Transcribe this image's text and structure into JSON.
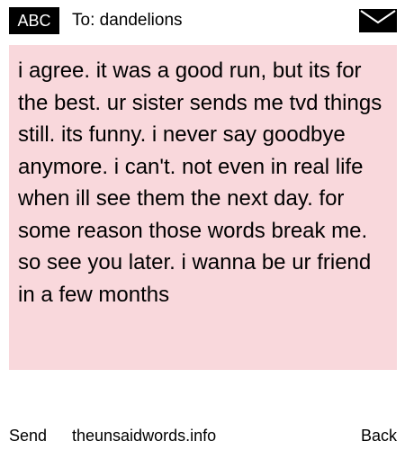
{
  "header": {
    "badge_label": "ABC",
    "recipient": "To: dandelions",
    "envelope_icon": "envelope-icon"
  },
  "message": {
    "text": "i agree. it was a good run, but its for the best. ur sister sends me tvd things still. its funny. i never say goodbye anymore. i can't. not even in real life when ill see them the next day. for some reason those words break me. so see you later. i wanna be ur friend in a few months",
    "background_color": "#f9d8dc"
  },
  "footer": {
    "send_label": "Send",
    "site_label": "theunsaidwords.info",
    "back_label": "Back"
  }
}
